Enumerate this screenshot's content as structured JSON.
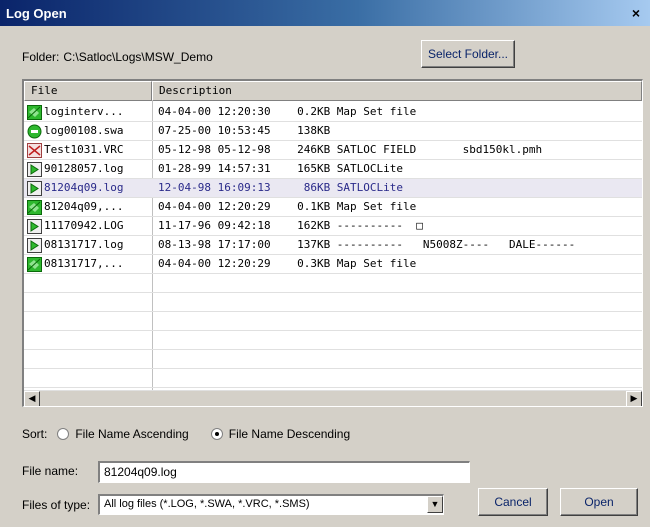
{
  "window": {
    "title": "Log Open",
    "close_glyph": "×"
  },
  "folder": {
    "label": "Folder:",
    "path": "C:\\Satloc\\Logs\\MSW_Demo",
    "select_button": "Select Folder..."
  },
  "list": {
    "columns": [
      "File",
      "Description"
    ],
    "rows": [
      {
        "icon": "map-set-icon",
        "file": "loginterv...",
        "desc": "04-04-00 12:20:30    0.2KB Map Set file"
      },
      {
        "icon": "swa-file-icon",
        "file": "log00108.swa",
        "desc": "07-25-00 10:53:45    138KB"
      },
      {
        "icon": "vrc-file-icon",
        "file": "Test1031.VRC",
        "desc": "05-12-98 05-12-98    246KB SATLOC FIELD       sbd150kl.pmh"
      },
      {
        "icon": "log-file-icon",
        "file": "90128057.log",
        "desc": "01-28-99 14:57:31    165KB SATLOCLite"
      },
      {
        "icon": "log-file-icon",
        "file": "81204q09.log",
        "desc": "12-04-98 16:09:13     86KB SATLOCLite",
        "selected": true
      },
      {
        "icon": "map-set-icon",
        "file": "81204q09,...",
        "desc": "04-04-00 12:20:29    0.1KB Map Set file"
      },
      {
        "icon": "log-file-icon",
        "file": "11170942.LOG",
        "desc": "11-17-96 09:42:18    162KB ----------  □"
      },
      {
        "icon": "log-file-icon",
        "file": "08131717.log",
        "desc": "08-13-98 17:17:00    137KB ----------   N5008Z----   DALE------"
      },
      {
        "icon": "map-set-icon",
        "file": "08131717,...",
        "desc": "04-04-00 12:20:29    0.3KB Map Set file"
      }
    ],
    "scroll_left_glyph": "◀",
    "scroll_right_glyph": "▶"
  },
  "sort": {
    "label": "Sort:",
    "ascending_label": "File Name Ascending",
    "descending_label": "File Name Descending",
    "selected": "descending"
  },
  "filename": {
    "label": "File name:",
    "value": "81204q09.log"
  },
  "filetype": {
    "label": "Files of type:",
    "value": "All log files (*.LOG, *.SWA, *.VRC, *.SMS)",
    "arrow_glyph": "▼"
  },
  "buttons": {
    "cancel": "Cancel",
    "open": "Open"
  },
  "colors": {
    "titlebar": "#0a246a",
    "dialog_bg": "#d4d0c8",
    "selected_row": "#eae8f2"
  }
}
